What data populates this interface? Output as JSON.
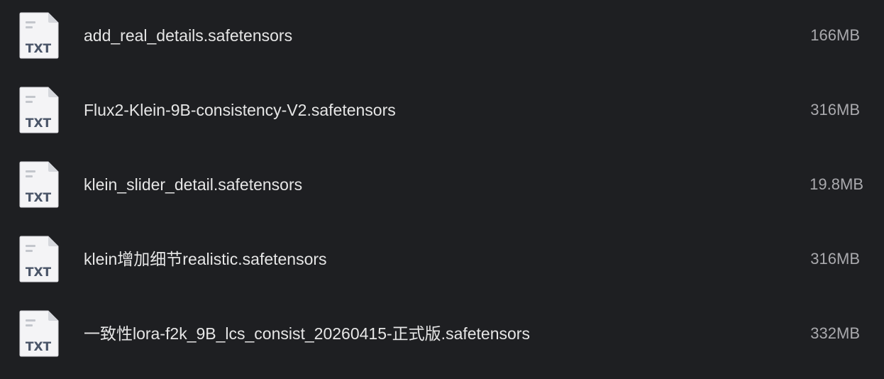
{
  "file_list": {
    "items": [
      {
        "name": "add_real_details.safetensors",
        "size": "166MB",
        "icon": "txt-file-icon",
        "icon_label": "TXT"
      },
      {
        "name": "Flux2-Klein-9B-consistency-V2.safetensors",
        "size": "316MB",
        "icon": "txt-file-icon",
        "icon_label": "TXT"
      },
      {
        "name": "klein_slider_detail.safetensors",
        "size": "19.8MB",
        "icon": "txt-file-icon",
        "icon_label": "TXT"
      },
      {
        "name": "klein增加细节realistic.safetensors",
        "size": "316MB",
        "icon": "txt-file-icon",
        "icon_label": "TXT"
      },
      {
        "name": "一致性lora-f2k_9B_lcs_consist_20260415-正式版.safetensors",
        "size": "332MB",
        "icon": "txt-file-icon",
        "icon_label": "TXT"
      }
    ]
  },
  "colors": {
    "background": "#1e1f22",
    "file_name": "#e6e6e6",
    "file_size": "#a9a9ad",
    "icon_body": "#f4f4f6",
    "icon_text": "#4a5568"
  }
}
